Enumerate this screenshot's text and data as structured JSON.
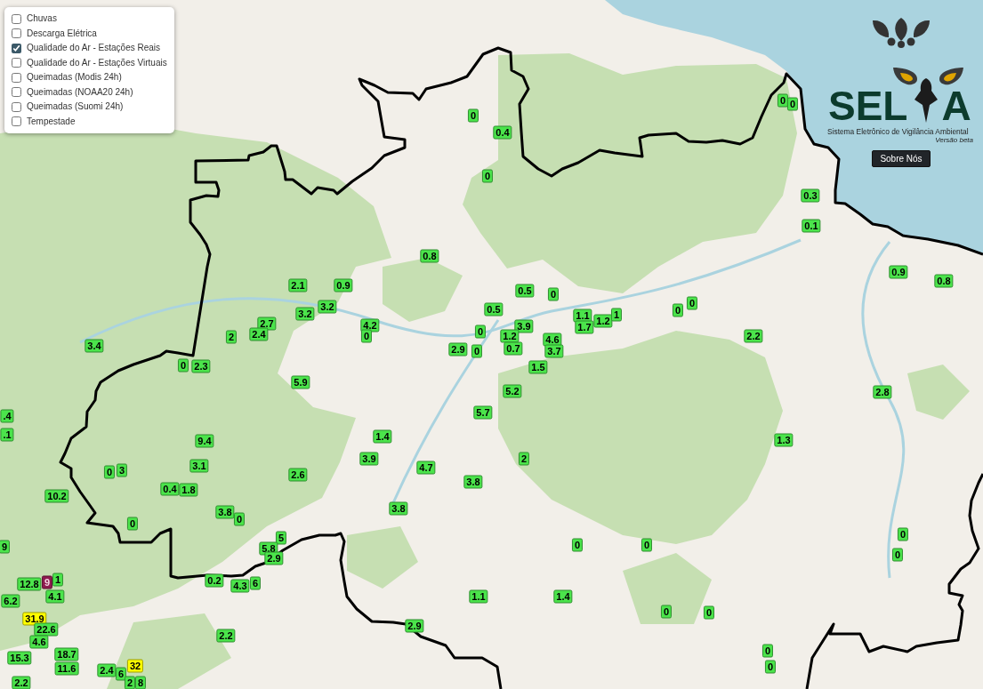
{
  "layer_control": {
    "layers": [
      {
        "label": "Chuvas",
        "checked": false
      },
      {
        "label": "Descarga Elétrica",
        "checked": false
      },
      {
        "label": "Qualidade do Ar - Estações Reais",
        "checked": true
      },
      {
        "label": "Qualidade do Ar - Estações Virtuais",
        "checked": false
      },
      {
        "label": "Queimadas (Modis 24h)",
        "checked": false
      },
      {
        "label": "Queimadas (NOAA20 24h)",
        "checked": false
      },
      {
        "label": "Queimadas (Suomi 24h)",
        "checked": false
      },
      {
        "label": "Tempestade",
        "checked": false
      }
    ]
  },
  "brand": {
    "name_start": "SEL",
    "name_end": "A",
    "subtitle": "Sistema Eletrônico de Vigilância Ambiental",
    "version": "Versão beta"
  },
  "about_button": "Sobre Nós",
  "markers": [
    {
      "value": "0",
      "color": "#4be44b"
    },
    {
      "value": "0",
      "color": "#4be44b"
    },
    {
      "value": "0",
      "color": "#4be44b"
    },
    {
      "value": "0.4",
      "color": "#4be44b"
    },
    {
      "value": "0",
      "color": "#4be44b"
    },
    {
      "value": "0.3",
      "color": "#4be44b"
    },
    {
      "value": "0.1",
      "color": "#4be44b"
    },
    {
      "value": "0.8",
      "color": "#4be44b"
    },
    {
      "value": "0.9",
      "color": "#4be44b"
    },
    {
      "value": "2.1",
      "color": "#4be44b"
    },
    {
      "value": "0.9",
      "color": "#4be44b"
    },
    {
      "value": "0.5",
      "color": "#4be44b"
    },
    {
      "value": "0",
      "color": "#4be44b"
    },
    {
      "value": "0.8",
      "color": "#4be44b"
    },
    {
      "value": "2.7",
      "color": "#4be44b"
    },
    {
      "value": "2",
      "color": "#4be44b"
    },
    {
      "value": "2.4",
      "color": "#4be44b"
    },
    {
      "value": "3.2",
      "color": "#4be44b"
    },
    {
      "value": "3.2",
      "color": "#4be44b"
    },
    {
      "value": "4.2",
      "color": "#4be44b"
    },
    {
      "value": "0",
      "color": "#4be44b"
    },
    {
      "value": "0.5",
      "color": "#4be44b"
    },
    {
      "value": "0",
      "color": "#4be44b"
    },
    {
      "value": "3.9",
      "color": "#4be44b"
    },
    {
      "value": "1.2",
      "color": "#4be44b"
    },
    {
      "value": "4.6",
      "color": "#4be44b"
    },
    {
      "value": "1.1",
      "color": "#4be44b"
    },
    {
      "value": "1.7",
      "color": "#4be44b"
    },
    {
      "value": "1.2",
      "color": "#4be44b"
    },
    {
      "value": "1",
      "color": "#4be44b"
    },
    {
      "value": "0",
      "color": "#4be44b"
    },
    {
      "value": "0",
      "color": "#4be44b"
    },
    {
      "value": "2.2",
      "color": "#4be44b"
    },
    {
      "value": "3.4",
      "color": "#4be44b"
    },
    {
      "value": "2.9",
      "color": "#4be44b"
    },
    {
      "value": "0",
      "color": "#4be44b"
    },
    {
      "value": "0.7",
      "color": "#4be44b"
    },
    {
      "value": "3.7",
      "color": "#4be44b"
    },
    {
      "value": "0",
      "color": "#4be44b"
    },
    {
      "value": "2.3",
      "color": "#4be44b"
    },
    {
      "value": "1.5",
      "color": "#4be44b"
    },
    {
      "value": "5.9",
      "color": "#4be44b"
    },
    {
      "value": "5.2",
      "color": "#4be44b"
    },
    {
      "value": "2.8",
      "color": "#4be44b"
    },
    {
      "value": ".4",
      "color": "#4be44b"
    },
    {
      "value": "5.7",
      "color": "#4be44b"
    },
    {
      "value": ".1",
      "color": "#4be44b"
    },
    {
      "value": "9.4",
      "color": "#4be44b"
    },
    {
      "value": "1.4",
      "color": "#4be44b"
    },
    {
      "value": "1.3",
      "color": "#4be44b"
    },
    {
      "value": "3.9",
      "color": "#4be44b"
    },
    {
      "value": "2",
      "color": "#4be44b"
    },
    {
      "value": "0",
      "color": "#4be44b"
    },
    {
      "value": "3",
      "color": "#4be44b"
    },
    {
      "value": "3.1",
      "color": "#4be44b"
    },
    {
      "value": "2.6",
      "color": "#4be44b"
    },
    {
      "value": "4.7",
      "color": "#4be44b"
    },
    {
      "value": "3.8",
      "color": "#4be44b"
    },
    {
      "value": "10.2",
      "color": "#4be44b"
    },
    {
      "value": "0.4",
      "color": "#4be44b"
    },
    {
      "value": "1.8",
      "color": "#4be44b"
    },
    {
      "value": "3.8",
      "color": "#4be44b"
    },
    {
      "value": "3.8",
      "color": "#4be44b"
    },
    {
      "value": "0",
      "color": "#4be44b"
    },
    {
      "value": "0",
      "color": "#4be44b"
    },
    {
      "value": "5",
      "color": "#4be44b"
    },
    {
      "value": "0",
      "color": "#4be44b"
    },
    {
      "value": "9",
      "color": "#4be44b"
    },
    {
      "value": "5.8",
      "color": "#4be44b"
    },
    {
      "value": "0",
      "color": "#4be44b"
    },
    {
      "value": "0",
      "color": "#4be44b"
    },
    {
      "value": "2.9",
      "color": "#4be44b"
    },
    {
      "value": "0",
      "color": "#4be44b"
    },
    {
      "value": "12.8",
      "color": "#4be44b"
    },
    {
      "value": "9",
      "color": "#8e1a4f"
    },
    {
      "value": "1",
      "color": "#4be44b"
    },
    {
      "value": "0.2",
      "color": "#4be44b"
    },
    {
      "value": "4.3",
      "color": "#4be44b"
    },
    {
      "value": "6",
      "color": "#4be44b"
    },
    {
      "value": "6.2",
      "color": "#4be44b"
    },
    {
      "value": "4.1",
      "color": "#4be44b"
    },
    {
      "value": "1.1",
      "color": "#4be44b"
    },
    {
      "value": "1.4",
      "color": "#4be44b"
    },
    {
      "value": "31.9",
      "color": "#ffff00"
    },
    {
      "value": "0",
      "color": "#4be44b"
    },
    {
      "value": "0",
      "color": "#4be44b"
    },
    {
      "value": "22.6",
      "color": "#4be44b"
    },
    {
      "value": "2.9",
      "color": "#4be44b"
    },
    {
      "value": "4.6",
      "color": "#4be44b"
    },
    {
      "value": "2.2",
      "color": "#4be44b"
    },
    {
      "value": "15.3",
      "color": "#4be44b"
    },
    {
      "value": "18.7",
      "color": "#4be44b"
    },
    {
      "value": "0",
      "color": "#4be44b"
    },
    {
      "value": "11.6",
      "color": "#4be44b"
    },
    {
      "value": "2.4",
      "color": "#4be44b"
    },
    {
      "value": "6",
      "color": "#4be44b"
    },
    {
      "value": "32",
      "color": "#ffff00"
    },
    {
      "value": "0",
      "color": "#4be44b"
    },
    {
      "value": "2.2",
      "color": "#4be44b"
    },
    {
      "value": "2",
      "color": "#4be44b"
    },
    {
      "value": "8",
      "color": "#4be44b"
    }
  ]
}
